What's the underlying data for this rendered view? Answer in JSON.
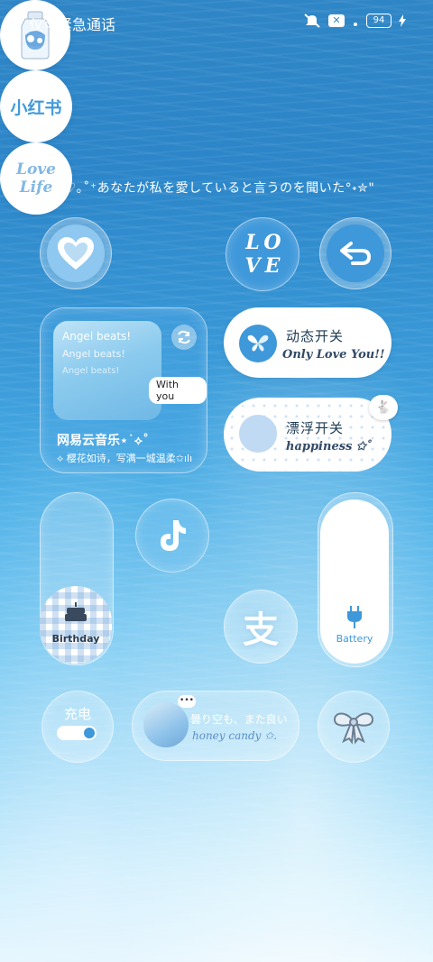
{
  "status": {
    "carrier_text": "仅可紧急通话",
    "battery_level": "94"
  },
  "quote": "\"♡｡˚⁺あなたが私を愛していると言うのを聞いた°˖✮\"",
  "row1": {
    "love_letters": [
      "L",
      "O",
      "V",
      "E"
    ]
  },
  "music": {
    "lyric_lines": [
      "Angel beats!",
      "Angel beats!",
      "Angel beats!"
    ],
    "with_you": "With you",
    "app_name": "网易云音乐⋆˙⟡˚",
    "subtitle": "⟡ 樱花如诗，写满一城温柔✩ılı"
  },
  "switch1": {
    "title": "动态开关",
    "subtitle": "Only Love You!!"
  },
  "switch2": {
    "title": "漂浮开关",
    "subtitle": "happiness ✩˚"
  },
  "apps": {
    "xiaohongshu": "小红书",
    "love_life": [
      "Love",
      "Life"
    ],
    "alipay_glyph": "支"
  },
  "birthday_label": "Birthday",
  "battery_label": "Battery",
  "charge": {
    "label": "充电",
    "on": true
  },
  "honey": {
    "line1": "曇り空も、また良い",
    "line2": "honey candy ✩."
  },
  "colors": {
    "accent": "#3b95d8",
    "light": "#bfdaf2"
  }
}
